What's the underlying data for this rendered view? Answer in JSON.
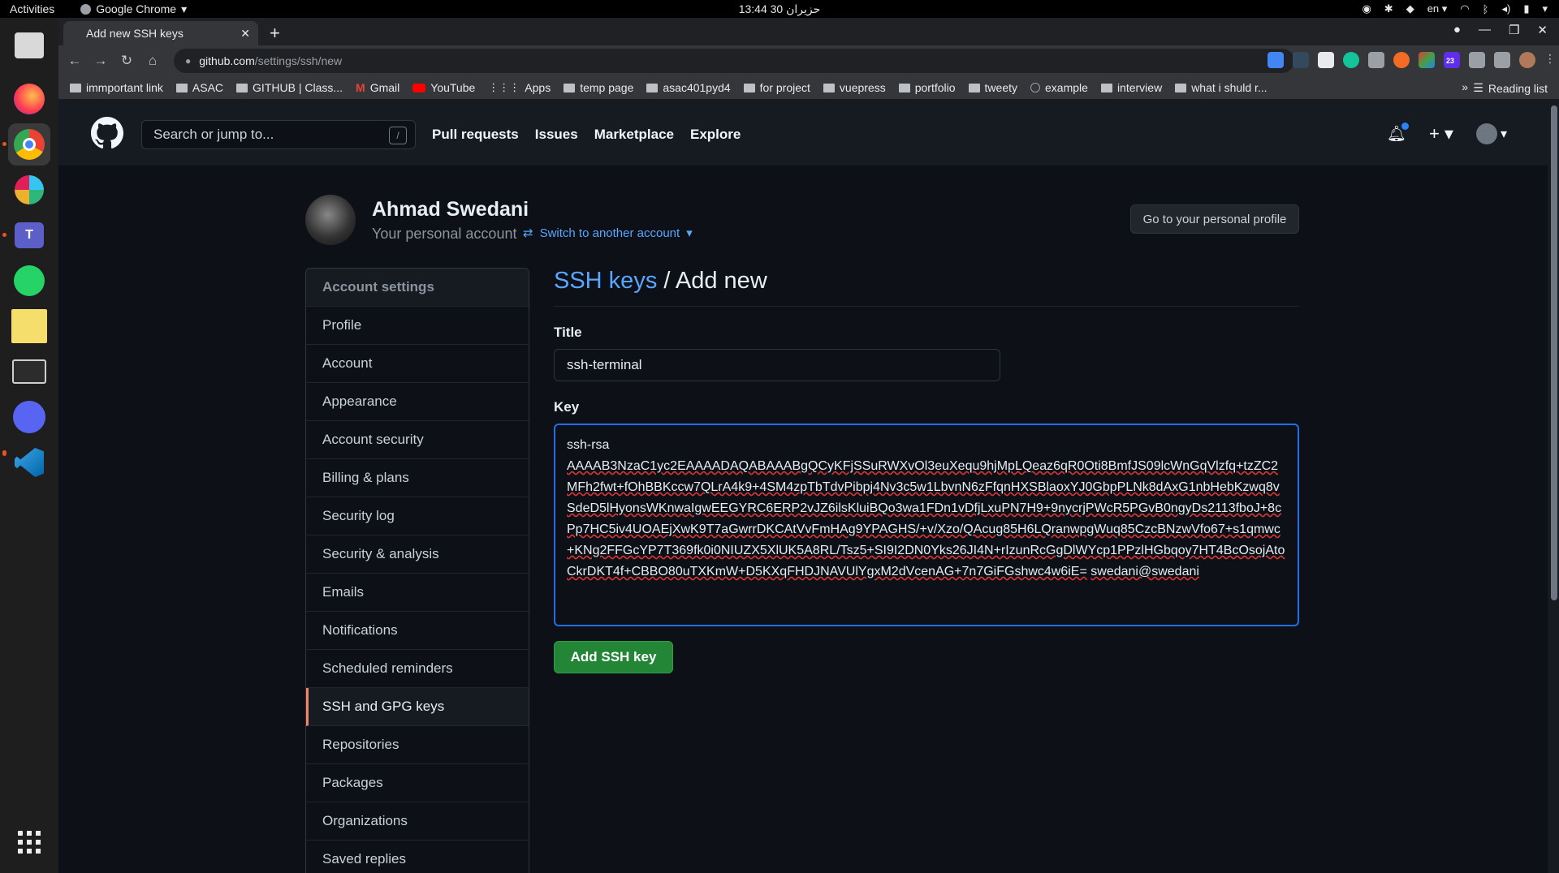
{
  "os": {
    "activities": "Activities",
    "app_name": "Google Chrome",
    "clock": "13:44  30 حزيران",
    "lang": "en"
  },
  "browser": {
    "tab_title": "Add new SSH keys",
    "url_domain": "github.com",
    "url_path": "/settings/ssh/new",
    "ext_badge": "23",
    "bookmarks": [
      {
        "label": "immportant link"
      },
      {
        "label": "ASAC"
      },
      {
        "label": "GITHUB | Class..."
      },
      {
        "label": "Gmail"
      },
      {
        "label": "YouTube"
      },
      {
        "label": "Apps"
      },
      {
        "label": "temp page"
      },
      {
        "label": "asac401pyd4"
      },
      {
        "label": "for project"
      },
      {
        "label": "vuepress"
      },
      {
        "label": "portfolio"
      },
      {
        "label": "tweety"
      },
      {
        "label": "example"
      },
      {
        "label": "interview"
      },
      {
        "label": "what i shuld r..."
      }
    ],
    "bookmarks_more": "»",
    "reading_list": "Reading list"
  },
  "github": {
    "search_placeholder": "Search or jump to...",
    "search_shortcut": "/",
    "nav": [
      "Pull requests",
      "Issues",
      "Marketplace",
      "Explore"
    ],
    "plus_symbol": "+"
  },
  "profile": {
    "name": "Ahmad Swedani",
    "subtitle": "Your personal account",
    "switch_label": "Switch to another account",
    "go_profile": "Go to your personal profile"
  },
  "menu": {
    "header": "Account settings",
    "items": [
      "Profile",
      "Account",
      "Appearance",
      "Account security",
      "Billing & plans",
      "Security log",
      "Security & analysis",
      "Emails",
      "Notifications",
      "Scheduled reminders",
      "SSH and GPG keys",
      "Repositories",
      "Packages",
      "Organizations",
      "Saved replies"
    ],
    "selected": "SSH and GPG keys"
  },
  "form": {
    "heading_link": "SSH keys",
    "heading_rest": " / Add new",
    "title_label": "Title",
    "title_value": "ssh-terminal",
    "key_label": "Key",
    "key_prefix": "ssh-rsa",
    "key_body": "AAAAB3NzaC1yc2EAAAADAQABAAABgQCyKFjSSuRWXvOl3euXequ9hjMpLQeaz6qR0Oti8BmfJS09lcWnGqVlzfq+tzZC2MFh2fwt+fOhBBKccw7QLrA4k9+4SM4zpTbTdvPibpj4Nv3c5w1LbvnN6zFfqnHXSBlaoxYJ0GbpPLNk8dAxG1nbHebKzwq8vSdeD5lHyonsWKnwaIgwEEGYRC6ERP2vJZ6ilsKluiBQo3wa1FDn1vDfjLxuPN7H9+9nycrjPWcR5PGvB0ngyDs2113fboJ+8cPp7HC5iv4UOAEjXwK9T7aGwrrDKCAtVvFmHAg9YPAGHS/+v/Xzo/QAcug85H6LQranwpgWuq85CzcBNzwVfo67+s1qmwc+KNg2FFGcYP7T369fk0i0NIUZX5XlUK5A8RL/Tsz5+SI9I2DN0Yks26JI4N+rIzunRcGgDlWYcp1PPzlHGbqoy7HT4BcOsojAtoCkrDKT4f+CBBO80uTXKmW+D5KXqFHDJNAVUlYgxM2dVcenAG+7n7GiFGshwc4w6iE=",
    "key_comment": "swedani@swedani",
    "submit": "Add SSH key"
  }
}
